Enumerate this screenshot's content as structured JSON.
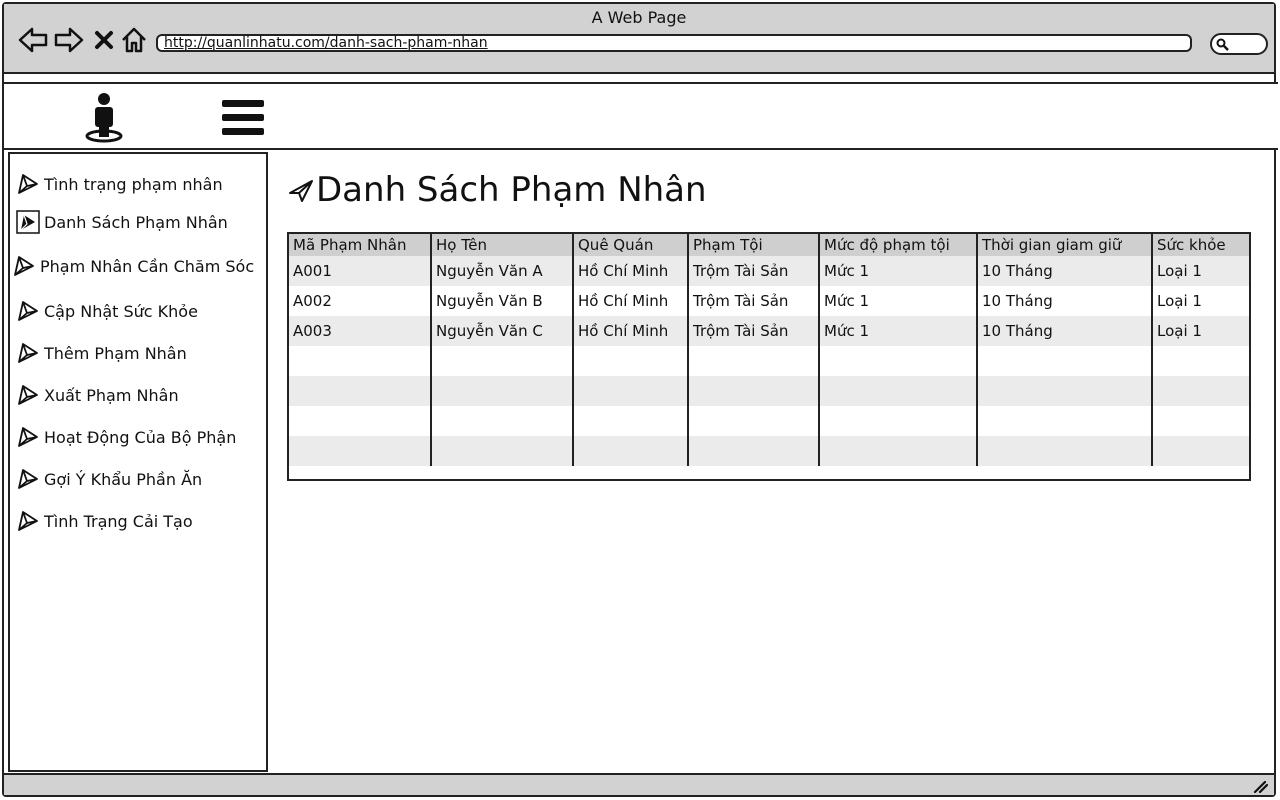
{
  "browser": {
    "title": "A Web Page",
    "url": "http://quanlinhatu.com/danh-sach-pham-nhan"
  },
  "sidebar": {
    "items": [
      {
        "label": "Tình trạng phạm nhân"
      },
      {
        "label": "Danh Sách Phạm Nhân"
      },
      {
        "label": "Phạm Nhân Cần Chăm Sóc"
      },
      {
        "label": "Cập Nhật Sức Khỏe"
      },
      {
        "label": "Thêm Phạm Nhân"
      },
      {
        "label": "Xuất Phạm Nhân"
      },
      {
        "label": "Hoạt Động Của Bộ Phận"
      },
      {
        "label": "Gợi Ý Khẩu Phần Ăn"
      },
      {
        "label": "Tình Trạng Cải Tạo"
      }
    ]
  },
  "main": {
    "title": "Danh Sách Phạm Nhân",
    "table": {
      "columns": [
        "Mã Phạm Nhân",
        "Họ Tên",
        "Quê Quán",
        "Phạm Tội",
        "Mức độ phạm tội",
        "Thời gian giam giữ",
        "Sức khỏe"
      ],
      "rows": [
        [
          "A001",
          "Nguyễn Văn A",
          "Hồ Chí Minh",
          "Trộm Tài Sản",
          "Mức 1",
          "10 Tháng",
          "Loại 1"
        ],
        [
          "A002",
          "Nguyễn Văn B",
          "Hồ Chí Minh",
          "Trộm Tài Sản",
          "Mức 1",
          "10 Tháng",
          "Loại 1"
        ],
        [
          "A003",
          "Nguyễn Văn C",
          "Hồ Chí Minh",
          "Trộm Tài Sản",
          "Mức 1",
          "10 Tháng",
          "Loại 1"
        ],
        [
          "",
          "",
          "",
          "",
          "",
          "",
          ""
        ],
        [
          "",
          "",
          "",
          "",
          "",
          "",
          ""
        ],
        [
          "",
          "",
          "",
          "",
          "",
          "",
          ""
        ],
        [
          "",
          "",
          "",
          "",
          "",
          "",
          ""
        ]
      ]
    }
  },
  "icons": {
    "back": "arrow-left-icon",
    "forward": "arrow-right-icon",
    "stop": "close-icon",
    "home": "home-icon",
    "search": "search-icon",
    "user": "user-location-icon",
    "menu": "hamburger-menu-icon",
    "sidebar_item": "paper-plane-icon",
    "title": "paper-plane-icon"
  }
}
